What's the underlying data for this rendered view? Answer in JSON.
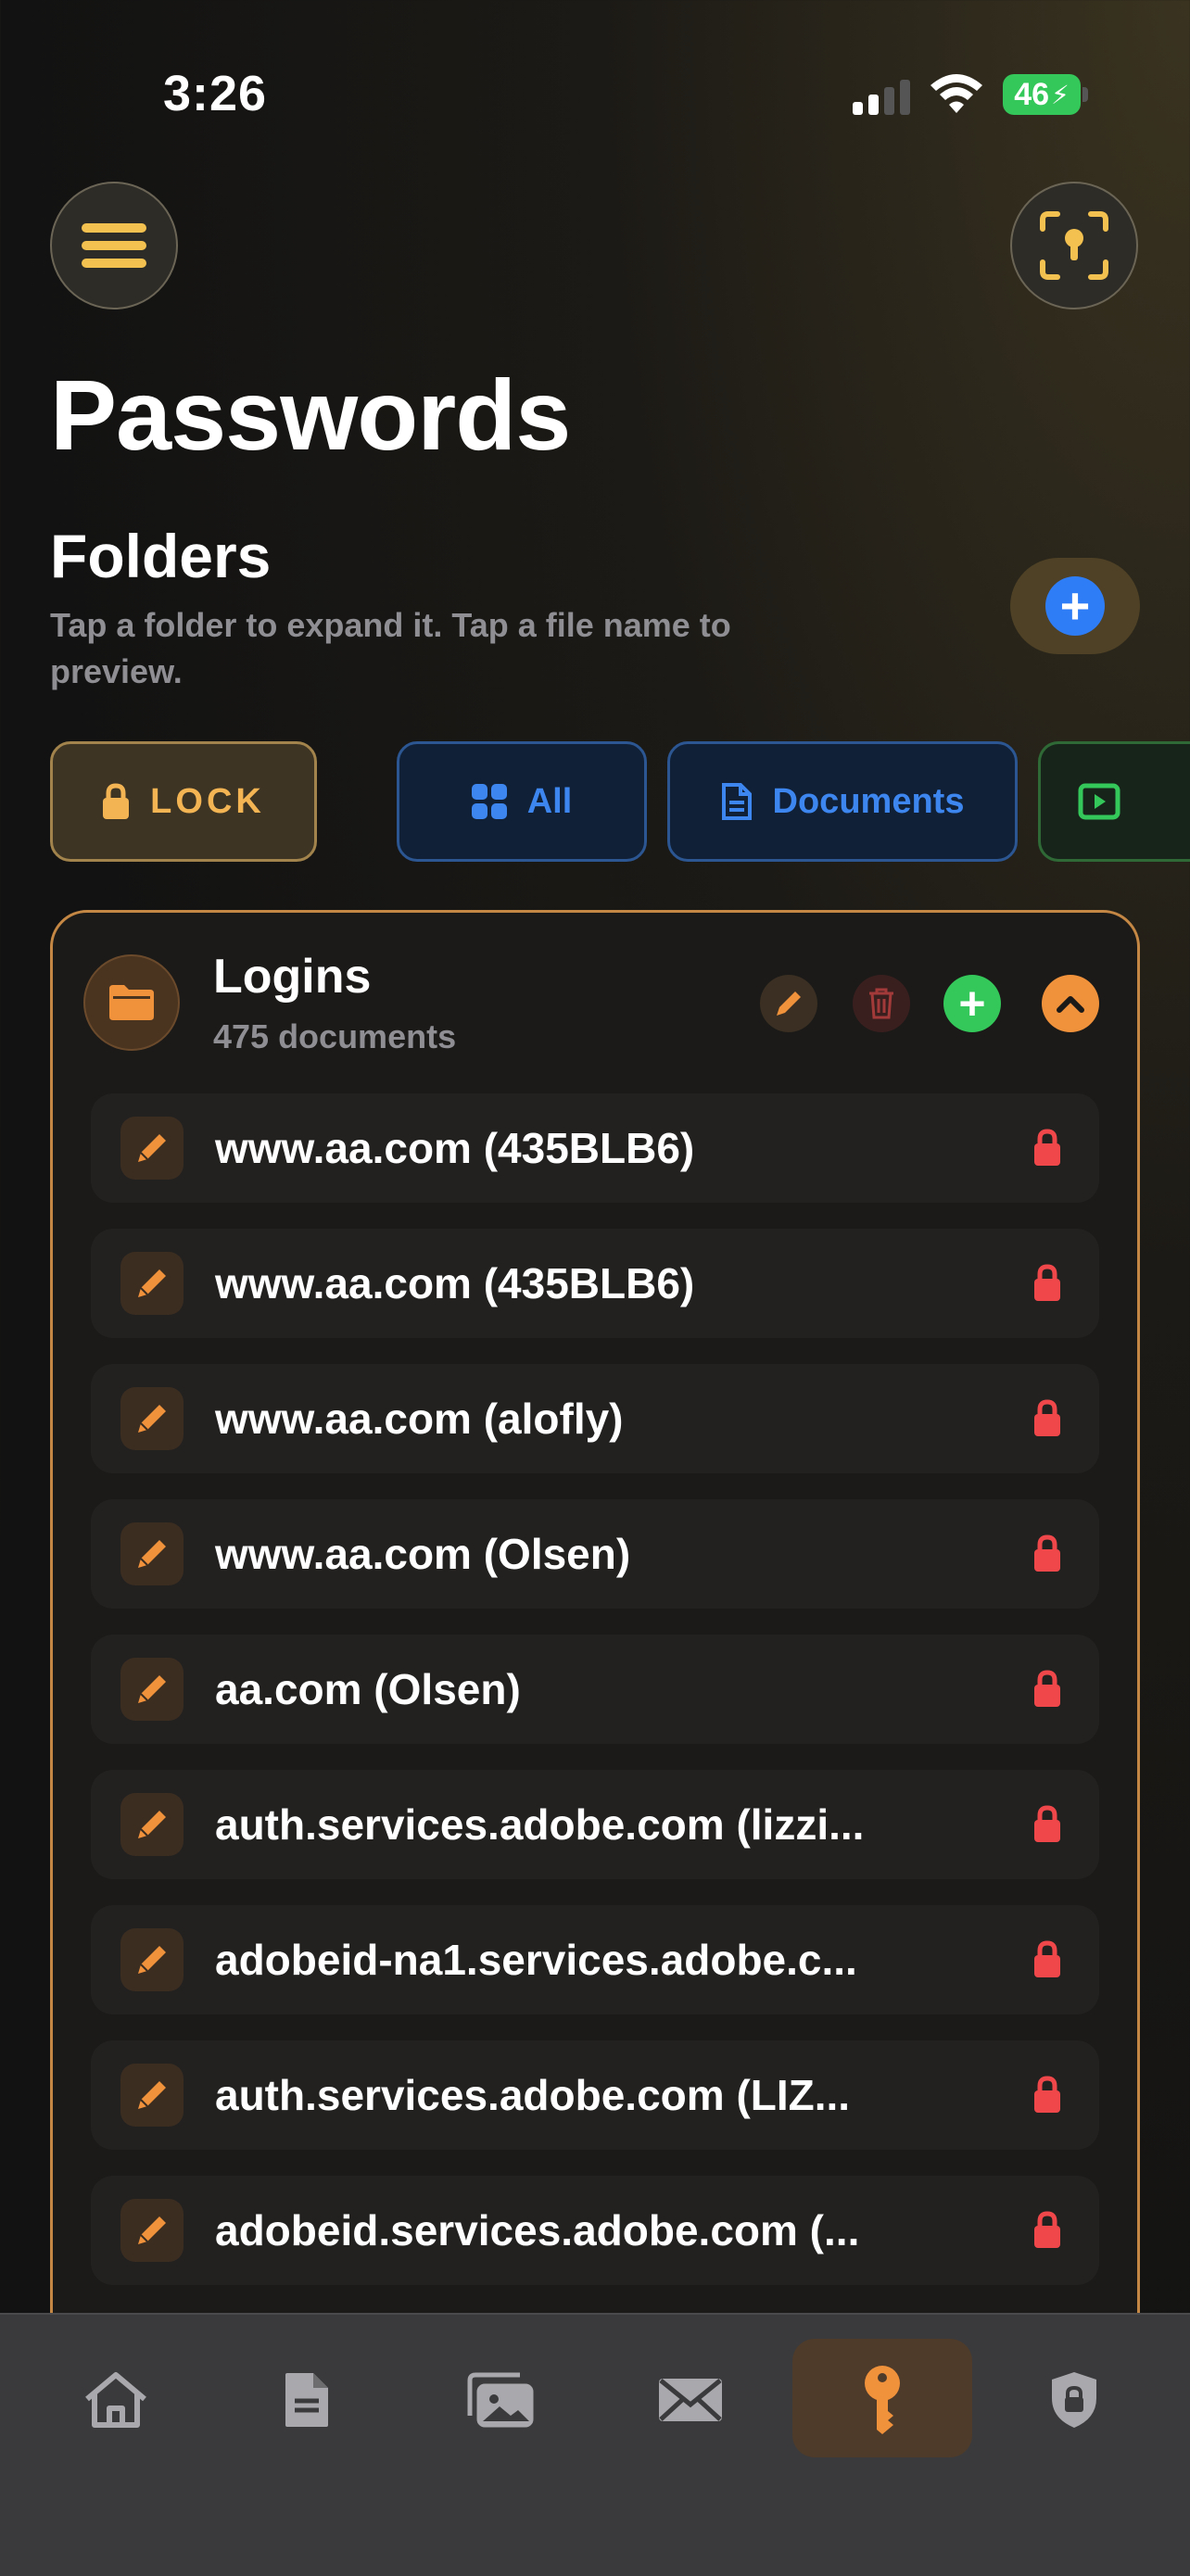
{
  "status_bar": {
    "time": "3:26",
    "battery": "46"
  },
  "header": {
    "title": "Passwords"
  },
  "folders_section": {
    "heading": "Folders",
    "subtitle": "Tap a folder to expand it. Tap a file name to preview."
  },
  "filters": [
    {
      "label": "LOCK",
      "icon": "lock-icon"
    },
    {
      "label": "All",
      "icon": "grid-icon"
    },
    {
      "label": "Documents",
      "icon": "document-icon"
    },
    {
      "label": "",
      "icon": "video-icon"
    }
  ],
  "folder": {
    "name": "Logins",
    "count": "475 documents",
    "items": [
      {
        "label": "www.aa.com (435BLB6)"
      },
      {
        "label": "www.aa.com (435BLB6)"
      },
      {
        "label": "www.aa.com (alofly)"
      },
      {
        "label": "www.aa.com (Olsen)"
      },
      {
        "label": "aa.com (Olsen)"
      },
      {
        "label": "auth.services.adobe.com (lizzi..."
      },
      {
        "label": "adobeid-na1.services.adobe.c..."
      },
      {
        "label": "auth.services.adobe.com (LIZ..."
      },
      {
        "label": "adobeid.services.adobe.com (..."
      }
    ]
  },
  "tab_bar": [
    {
      "icon": "home-icon"
    },
    {
      "icon": "document-icon"
    },
    {
      "icon": "photos-icon"
    },
    {
      "icon": "mail-icon"
    },
    {
      "icon": "key-icon",
      "active": true
    },
    {
      "icon": "shield-lock-icon"
    }
  ],
  "colors": {
    "accent": "#f0913c",
    "blue": "#2f7df6",
    "green": "#34c759",
    "lock_red": "#f0484a"
  }
}
